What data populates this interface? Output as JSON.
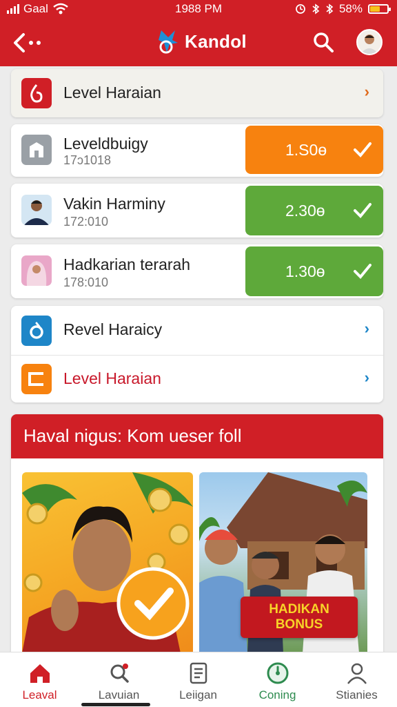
{
  "status_bar": {
    "carrier": "Gaal",
    "time": "1988 PM",
    "battery": "58%",
    "battery_level": 0.58
  },
  "header": {
    "brand": "Kandol"
  },
  "rows": [
    {
      "title": "Level Haraian"
    },
    {
      "title": "Leveldbuigy",
      "sub": "17ↄ1018",
      "amount": "1.S0ɵ"
    },
    {
      "title": "Vakin Harminy",
      "sub": "172:010",
      "amount": "2.30ɵ"
    },
    {
      "title": "Hadkarian terarah",
      "sub": "178:010",
      "amount": "1.30ɵ"
    },
    {
      "title": "Revel Haraicy"
    },
    {
      "title": "Level Haraian"
    }
  ],
  "promo": {
    "title": "Haval nigus: Kom ueser foll",
    "badge_line1": "HADIKAN",
    "badge_line2": "BONUS"
  },
  "bottom_nav": [
    {
      "label": "Leaval",
      "icon": "home-icon"
    },
    {
      "label": "Lavuian",
      "icon": "search-icon"
    },
    {
      "label": "Leiigan",
      "icon": "document-icon"
    },
    {
      "label": "Coning",
      "icon": "gauge-icon"
    },
    {
      "label": "Stianies",
      "icon": "person-icon"
    }
  ],
  "colors": {
    "brand_red": "#d01f26",
    "orange": "#f7820f",
    "green": "#5ea93a",
    "nav_active": "#d01f26",
    "nav_green": "#2e8b4f"
  }
}
